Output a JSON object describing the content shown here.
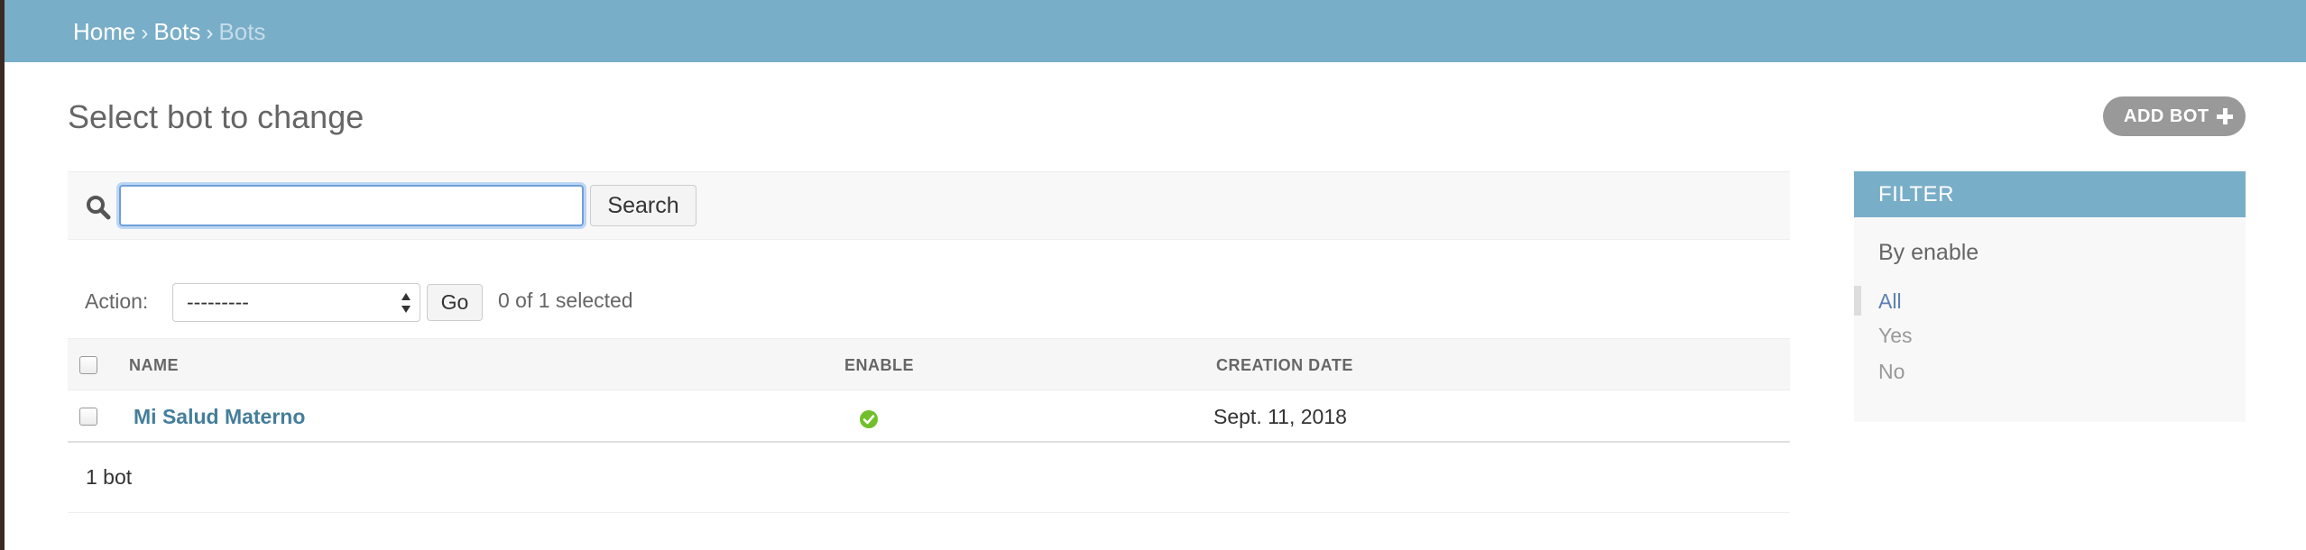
{
  "breadcrumbs": {
    "home": "Home",
    "separator": "›",
    "app": "Bots",
    "current": "Bots"
  },
  "page_title": "Select bot to change",
  "add_button": {
    "label": "ADD BOT",
    "icon": "plus-icon"
  },
  "search": {
    "icon": "search-icon",
    "value": "",
    "button_label": "Search"
  },
  "actions": {
    "label": "Action:",
    "selected": "---------",
    "go_label": "Go",
    "counter": "0 of 1 selected"
  },
  "table": {
    "columns": [
      "NAME",
      "ENABLE",
      "CREATION DATE"
    ],
    "rows": [
      {
        "name": "Mi Salud Materno",
        "enable": true,
        "enable_icon": "check-circle-icon",
        "creation_date": "Sept. 11, 2018"
      }
    ]
  },
  "paginator": {
    "text": "1 bot"
  },
  "filter": {
    "header": "FILTER",
    "title": "By enable",
    "options": [
      {
        "label": "All",
        "selected": true
      },
      {
        "label": "Yes",
        "selected": false
      },
      {
        "label": "No",
        "selected": false
      }
    ]
  },
  "colors": {
    "header_bg": "#79aec8",
    "link": "#447e9b",
    "success": "#70bf2b",
    "button_bg": "#999999"
  }
}
